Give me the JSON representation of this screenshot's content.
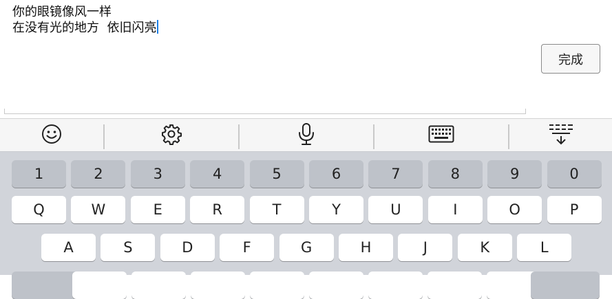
{
  "editor": {
    "lines": [
      "你的眼镜像风一样",
      "在没有光的地方  依旧闪亮"
    ],
    "done_label": "完成"
  },
  "toolbar": {
    "items": [
      {
        "icon": "emoji-icon"
      },
      {
        "icon": "gear-icon"
      },
      {
        "icon": "microphone-icon"
      },
      {
        "icon": "keyboard-icon"
      },
      {
        "icon": "hide-keyboard-icon"
      }
    ]
  },
  "keyboard": {
    "number_row": [
      "1",
      "2",
      "3",
      "4",
      "5",
      "6",
      "7",
      "8",
      "9",
      "0"
    ],
    "row1": [
      "Q",
      "W",
      "E",
      "R",
      "T",
      "Y",
      "U",
      "I",
      "O",
      "P"
    ],
    "row2": [
      "A",
      "S",
      "D",
      "F",
      "G",
      "H",
      "J",
      "K",
      "L"
    ]
  },
  "colors": {
    "caret": "#1a7fe6",
    "keyboard_bg": "#d1d4da",
    "number_key_bg": "#bec2c9"
  }
}
